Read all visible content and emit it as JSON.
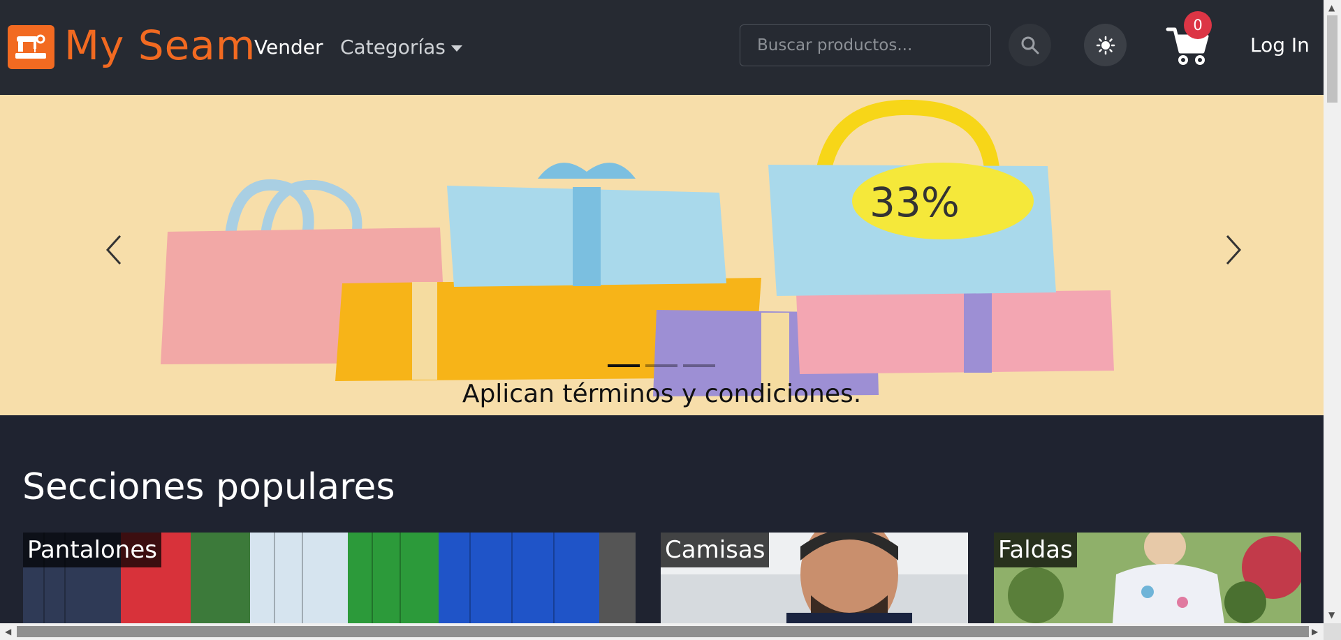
{
  "navbar": {
    "brand": "My Seam",
    "logo_icon": "sewing-machine-icon",
    "links": {
      "sell": "Vender",
      "categories": "Categorías"
    },
    "search": {
      "placeholder": "Buscar productos...",
      "value": ""
    },
    "search_icon": "search-icon",
    "theme_icon": "sun-icon",
    "cart": {
      "icon": "cart-icon",
      "count": "0"
    },
    "login": "Log In"
  },
  "carousel": {
    "caption": "Aplican términos y condiciones.",
    "badge_text": "33%",
    "slide_count": 3,
    "active_slide": 1,
    "prev_icon": "chevron-left-icon",
    "next_icon": "chevron-right-icon"
  },
  "sections": {
    "title": "Secciones populares",
    "cards": [
      {
        "label": "Pantalones"
      },
      {
        "label": "Camisas"
      },
      {
        "label": "Faldas"
      }
    ]
  },
  "colors": {
    "brand_orange": "#f26a21",
    "navbar_bg": "#262a32",
    "page_bg": "#1f2330",
    "badge_red": "#dc3545",
    "banner_bg": "#f7deaa"
  }
}
